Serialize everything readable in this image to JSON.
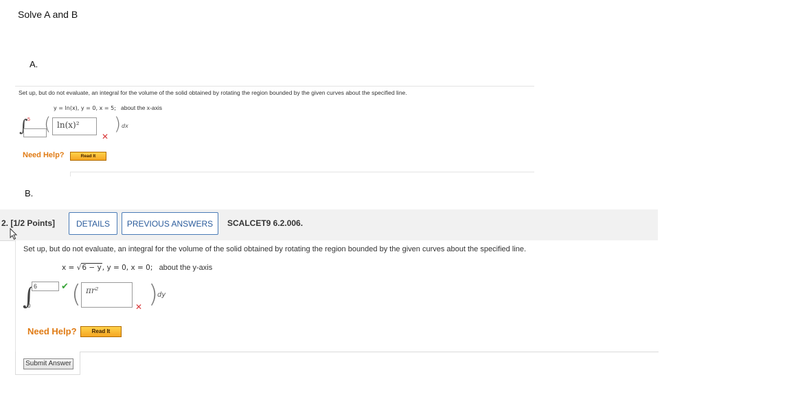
{
  "doc": {
    "title": "Solve A and B",
    "label_a": "A.",
    "label_b": "B."
  },
  "part_a": {
    "prompt": "Set up, but do not evaluate, an integral for the volume of the solid obtained by rotating the region bounded by the given curves about the specified line.",
    "curves": "y = ln(x),   y = 0,   x = 5;",
    "about": "about the x-axis",
    "upper_limit": "5",
    "lower_limit": "",
    "integrand_value": "ln(x)²",
    "differential": "dx",
    "need_help": "Need Help?",
    "read_it": "Read It"
  },
  "part_b": {
    "points": "2.  [1/2 Points]",
    "details": "DETAILS",
    "previous_answers": "PREVIOUS ANSWERS",
    "code": "SCALCET9 6.2.006.",
    "prompt": "Set up, but do not evaluate, an integral for the volume of the solid obtained by rotating the region bounded by the given curves about the specified line.",
    "curves_lhs": "x = ",
    "curves_rad": "6 − y",
    "curves_rest": ",   y = 0,   x = 0;",
    "about": "about the y-axis",
    "upper_limit": "6",
    "lower_limit": "0",
    "integrand_value": "πr²",
    "differential": "dy",
    "need_help": "Need Help?",
    "read_it": "Read It",
    "submit": "Submit Answer"
  },
  "colors": {
    "error": "#d9383a",
    "correct": "#3aa53a",
    "help": "#e07b14",
    "link_blue": "#2b5c9c"
  }
}
